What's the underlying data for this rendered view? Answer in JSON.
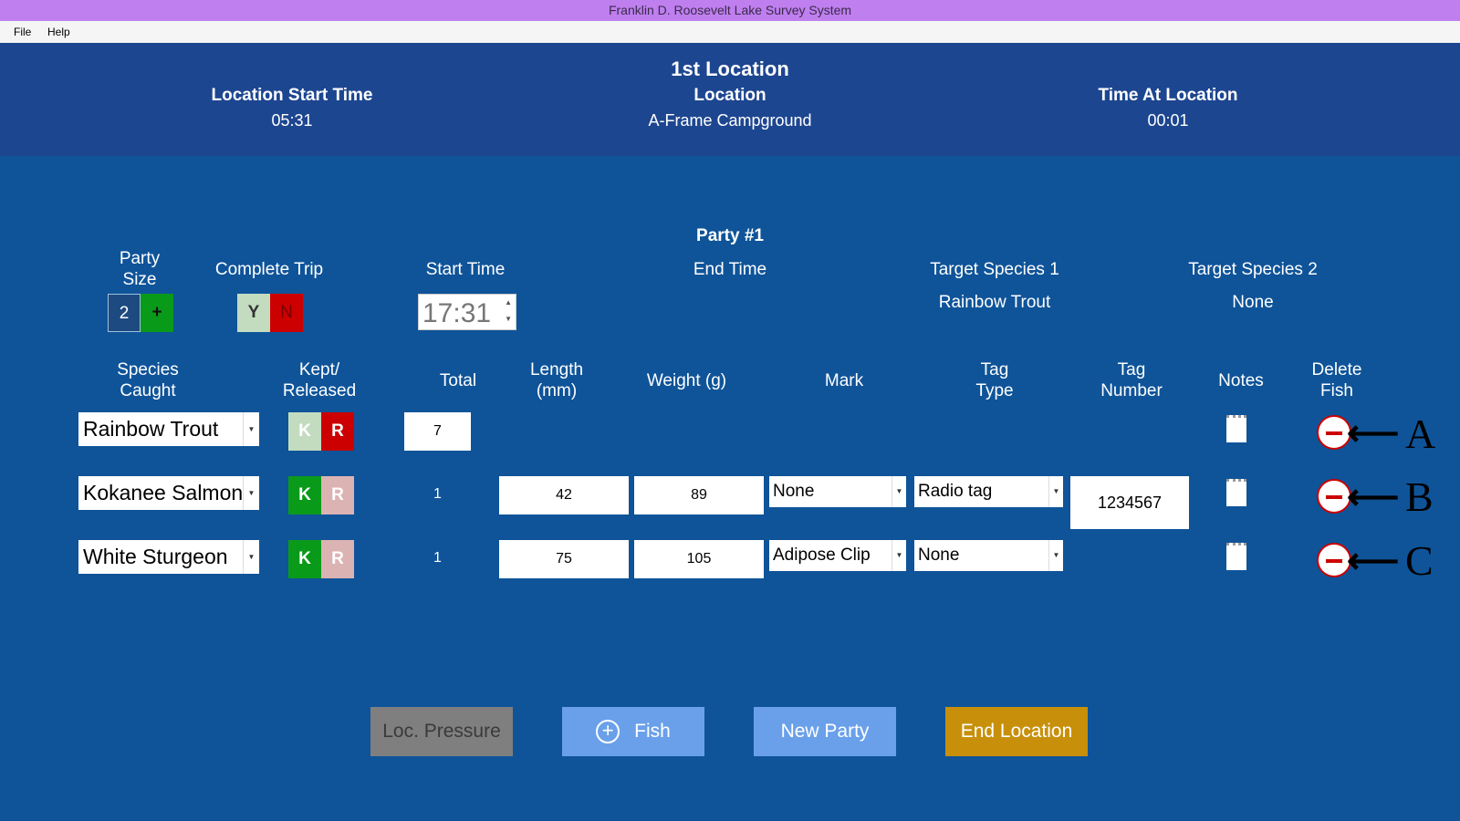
{
  "window": {
    "title": "Franklin D. Roosevelt Lake Survey System"
  },
  "menu": {
    "file": "File",
    "help": "Help"
  },
  "header": {
    "location_heading": "1st Location",
    "start_label": "Location Start Time",
    "start_value": "05:31",
    "location_label": "Location",
    "location_value": "A-Frame Campground",
    "time_label": "Time At Location",
    "time_value": "00:01"
  },
  "party": {
    "title": "Party #1",
    "size_label": "Party\nSize",
    "size_value": "2",
    "size_plus": "+",
    "complete_label": "Complete Trip",
    "yes": "Y",
    "no": "N",
    "start_label": "Start Time",
    "start_value": "17:31",
    "end_label": "End Time",
    "target1_label": "Target Species 1",
    "target1_value": "Rainbow Trout",
    "target2_label": "Target Species 2",
    "target2_value": "None"
  },
  "columns": {
    "species": "Species\nCaught",
    "kept": "Kept/\nReleased",
    "total": "Total",
    "length": "Length\n(mm)",
    "weight": "Weight (g)",
    "mark": "Mark",
    "tag_type": "Tag\nType",
    "tag_number": "Tag\nNumber",
    "notes": "Notes",
    "delete": "Delete\nFish"
  },
  "rows": [
    {
      "species": "Rainbow Trout",
      "k": "K",
      "r": "R",
      "total": "7",
      "annotation": "A"
    },
    {
      "species": "Kokanee Salmon",
      "k": "K",
      "r": "R",
      "total": "1",
      "length": "42",
      "weight": "89",
      "mark": "None",
      "tag_type": "Radio tag",
      "tag_number": "1234567",
      "annotation": "B"
    },
    {
      "species": "White Sturgeon",
      "k": "K",
      "r": "R",
      "total": "1",
      "length": "75",
      "weight": "105",
      "mark": "Adipose Clip",
      "tag_type": "None",
      "annotation": "C"
    }
  ],
  "buttons": {
    "loc_pressure": "Loc. Pressure",
    "fish": "Fish",
    "new_party": "New Party",
    "end_location": "End Location"
  },
  "colors": {
    "title_bar": "#bf7fef",
    "header": "#1d4690",
    "body": "#0f5499",
    "kept": "#0a9a1a",
    "released": "#cc0000",
    "end_location": "#c8900a"
  }
}
